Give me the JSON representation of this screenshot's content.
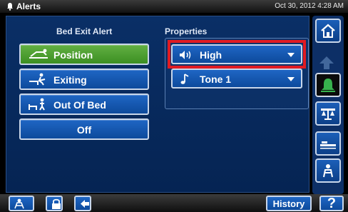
{
  "header": {
    "title": "Alerts",
    "datetime": "Oct 30, 2012 4:28 AM",
    "icon": "bell-icon"
  },
  "bed_exit": {
    "section_title": "Bed Exit Alert",
    "options": [
      {
        "label": "Position",
        "icon": "position-icon",
        "selected": true
      },
      {
        "label": "Exiting",
        "icon": "exiting-icon",
        "selected": false
      },
      {
        "label": "Out Of Bed",
        "icon": "out-of-bed-icon",
        "selected": false
      },
      {
        "label": "Off",
        "icon": "",
        "selected": false
      }
    ]
  },
  "properties": {
    "section_title": "Properties",
    "volume": {
      "value": "High",
      "icon": "speaker-icon"
    },
    "tone": {
      "value": "Tone 1",
      "icon": "music-note-icon"
    }
  },
  "side_nav": {
    "items": [
      "home-icon",
      "scroll-up-icon",
      "bell-icon",
      "scale-icon",
      "bed-icon",
      "people-icon"
    ]
  },
  "bottom": {
    "history_label": "History",
    "help_label": "?"
  },
  "colors": {
    "selected": "#4aa12f",
    "button": "#1a5cb4",
    "highlight": "#e01b22",
    "panel": "#0a2f66",
    "alert_bell": "#37b24d"
  }
}
